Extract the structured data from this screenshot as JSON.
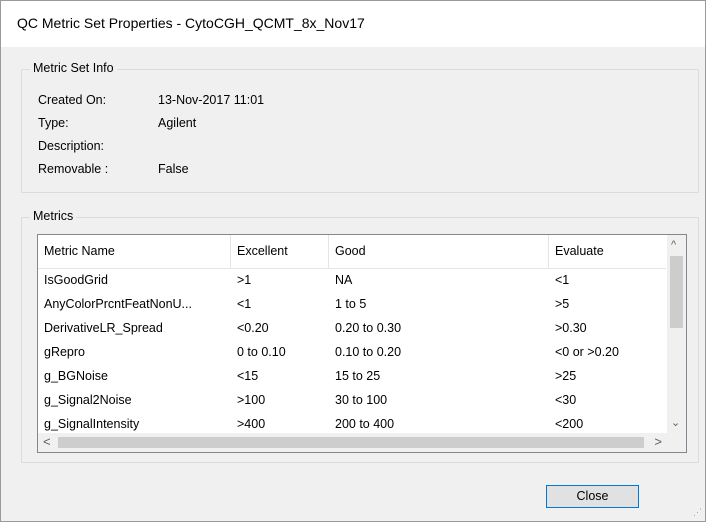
{
  "window": {
    "title": "QC Metric Set Properties - CytoCGH_QCMT_8x_Nov17"
  },
  "info_group": {
    "legend": "Metric Set Info",
    "created_on_label": "Created On:",
    "created_on_value": "13-Nov-2017 11:01",
    "type_label": "Type:",
    "type_value": "Agilent",
    "description_label": "Description:",
    "description_value": "",
    "removable_label": "Removable :",
    "removable_value": "False"
  },
  "metrics_group": {
    "legend": "Metrics",
    "columns": [
      "Metric Name",
      "Excellent",
      "Good",
      "Evaluate"
    ],
    "rows": [
      [
        "IsGoodGrid",
        ">1",
        "NA",
        "<1"
      ],
      [
        "AnyColorPrcntFeatNonU...",
        "<1",
        "1 to 5",
        ">5"
      ],
      [
        "DerivativeLR_Spread",
        "<0.20",
        "0.20 to 0.30",
        ">0.30"
      ],
      [
        "gRepro",
        "0 to 0.10",
        "0.10 to 0.20",
        "<0 or >0.20"
      ],
      [
        "g_BGNoise",
        "<15",
        "15 to 25",
        ">25"
      ],
      [
        "g_Signal2Noise",
        ">100",
        "30 to 100",
        "<30"
      ],
      [
        "g_SignalIntensity",
        ">400",
        "200 to 400",
        "<200"
      ]
    ]
  },
  "buttons": {
    "close": "Close"
  },
  "icons": {
    "scroll_up": "^",
    "scroll_down": "⌄",
    "scroll_left": "<",
    "scroll_right": ">",
    "grip": "⋰"
  }
}
